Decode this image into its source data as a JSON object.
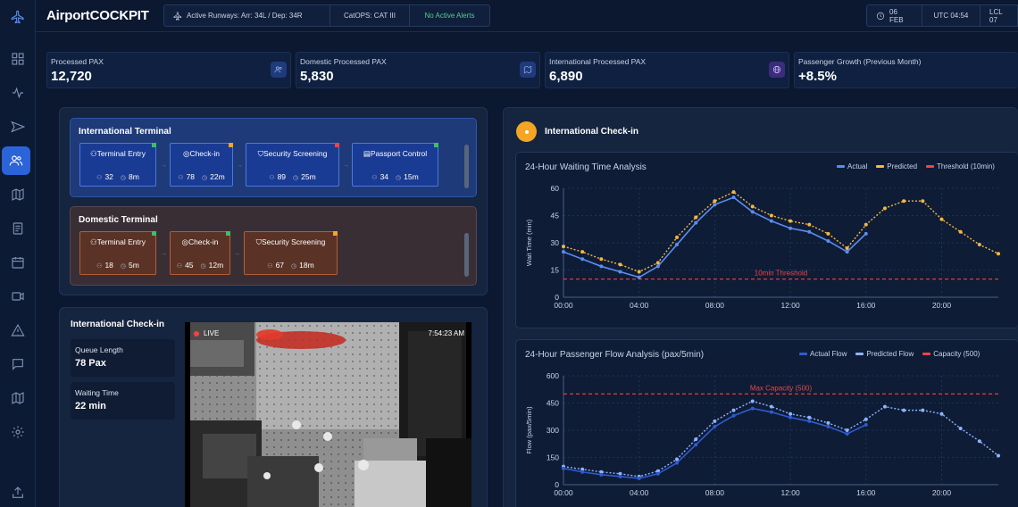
{
  "header": {
    "title": "AirportCOCKPIT",
    "runways": "Active Runways: Arr: 34L / Dep: 34R",
    "catops": "CatOPS: CAT III",
    "alerts": "No Active Alerts",
    "date": "06 FEB",
    "utc": "UTC 04:54",
    "lcl": "LCL 07"
  },
  "sidebar": {
    "icons": [
      "plane-icon",
      "dashboard-icon",
      "activity-icon",
      "flight-icon",
      "users-icon",
      "map-icon",
      "document-icon",
      "calendar-icon",
      "video-icon",
      "alert-icon",
      "chat-icon",
      "map-alt-icon",
      "settings-icon",
      "share-icon"
    ],
    "active": "users-icon"
  },
  "kpis": [
    {
      "label": "Processed PAX",
      "value": "12,720",
      "icon": "users-icon"
    },
    {
      "label": "Domestic Processed PAX",
      "value": "5,830",
      "icon": "map-icon"
    },
    {
      "label": "International Processed PAX",
      "value": "6,890",
      "icon": "globe-icon"
    },
    {
      "label": "Passenger Growth (Previous Month)",
      "value": "+8.5%"
    }
  ],
  "international_terminal": {
    "title": "International Terminal",
    "steps": [
      {
        "name": "Terminal Entry",
        "pax": "32",
        "time": "8m",
        "status_color": "#3bbf6b"
      },
      {
        "name": "Check-in",
        "pax": "78",
        "time": "22m",
        "status_color": "#f5a524"
      },
      {
        "name": "Security Screening",
        "pax": "89",
        "time": "25m",
        "status_color": "#ef4444"
      },
      {
        "name": "Passport Control",
        "pax": "34",
        "time": "15m",
        "status_color": "#3bbf6b"
      }
    ]
  },
  "domestic_terminal": {
    "title": "Domestic Terminal",
    "steps": [
      {
        "name": "Terminal Entry",
        "pax": "18",
        "time": "5m",
        "status_color": "#3bbf6b"
      },
      {
        "name": "Check-in",
        "pax": "45",
        "time": "12m",
        "status_color": "#3bbf6b"
      },
      {
        "name": "Security Screening",
        "pax": "67",
        "time": "18m",
        "status_color": "#f5a524"
      }
    ]
  },
  "checkin_panel": {
    "title": "International Check-in",
    "queue_label": "Queue Length",
    "queue_value": "78 Pax",
    "wait_label": "Waiting Time",
    "wait_value": "22 min",
    "live_label": "LIVE",
    "timestamp": "7:54:23 AM"
  },
  "right_panel": {
    "title": "International Check-in",
    "accent": "#f5a524"
  },
  "chart_data": [
    {
      "type": "line",
      "title": "24-Hour Waiting Time Analysis",
      "ylabel": "Wait Time (min)",
      "xlabel": "",
      "ylim": [
        0,
        60
      ],
      "yticks": [
        "0",
        "15",
        "30",
        "45",
        "60"
      ],
      "xlim": [
        0,
        23
      ],
      "xticks": [
        "00:00",
        "04:00",
        "08:00",
        "12:00",
        "16:00",
        "20:00"
      ],
      "grid": true,
      "legend": "top-right",
      "threshold": {
        "name": "Threshold (10min)",
        "value": 10,
        "label": "10min Threshold",
        "color": "#ef4444"
      },
      "series": [
        {
          "name": "Actual",
          "color": "#5b8def",
          "style": "solid",
          "x": [
            0,
            1,
            2,
            3,
            4,
            5,
            6,
            7,
            8,
            9,
            10,
            11,
            12,
            13,
            14,
            15,
            16
          ],
          "values": [
            25,
            21,
            17,
            14,
            11,
            17,
            29,
            41,
            51,
            55,
            47,
            42,
            38,
            36,
            31,
            25,
            35
          ]
        },
        {
          "name": "Predicted",
          "color": "#f5b841",
          "style": "dotted",
          "x": [
            0,
            1,
            2,
            3,
            4,
            5,
            6,
            7,
            8,
            9,
            10,
            11,
            12,
            13,
            14,
            15,
            16,
            17,
            18,
            19,
            20,
            21,
            22,
            23
          ],
          "values": [
            28,
            25,
            21,
            18,
            14,
            19,
            33,
            44,
            53,
            58,
            50,
            45,
            42,
            40,
            35,
            27,
            40,
            49,
            53,
            53,
            43,
            36,
            29,
            24
          ]
        }
      ]
    },
    {
      "type": "line",
      "title": "24-Hour Passenger Flow Analysis (pax/5min)",
      "ylabel": "Flow (pax/5min)",
      "xlabel": "",
      "ylim": [
        0,
        600
      ],
      "yticks": [
        "0",
        "150",
        "300",
        "450",
        "600"
      ],
      "xlim": [
        0,
        23
      ],
      "xticks": [
        "00:00",
        "04:00",
        "08:00",
        "12:00",
        "16:00",
        "20:00"
      ],
      "grid": true,
      "legend": "top-right",
      "threshold": {
        "name": "Capacity (500)",
        "value": 500,
        "label": "Max Capacity (500)",
        "color": "#ef4444"
      },
      "series": [
        {
          "name": "Actual Flow",
          "color": "#2f5bd0",
          "style": "solid",
          "x": [
            0,
            1,
            2,
            3,
            4,
            5,
            6,
            7,
            8,
            9,
            10,
            11,
            12,
            13,
            14,
            15,
            16
          ],
          "values": [
            90,
            70,
            55,
            45,
            35,
            60,
            120,
            220,
            320,
            380,
            420,
            400,
            370,
            350,
            320,
            280,
            330
          ]
        },
        {
          "name": "Predicted Flow",
          "color": "#8fb4ff",
          "style": "dotted",
          "x": [
            0,
            1,
            2,
            3,
            4,
            5,
            6,
            7,
            8,
            9,
            10,
            11,
            12,
            13,
            14,
            15,
            16,
            17,
            18,
            19,
            20,
            21,
            22,
            23
          ],
          "values": [
            100,
            85,
            70,
            60,
            45,
            75,
            140,
            250,
            350,
            410,
            460,
            430,
            390,
            370,
            340,
            300,
            360,
            430,
            410,
            410,
            390,
            310,
            240,
            160
          ]
        }
      ]
    }
  ]
}
